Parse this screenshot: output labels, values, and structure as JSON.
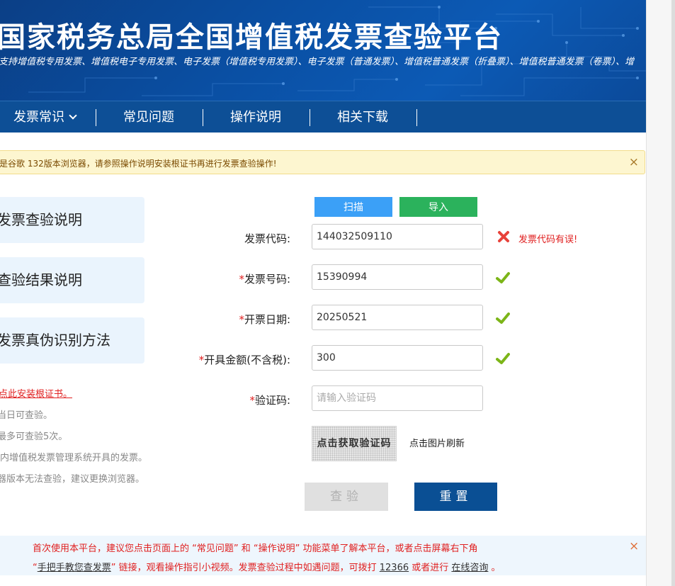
{
  "header": {
    "title": "国家税务总局全国增值税发票查验平台",
    "subtitle": "支持增值税专用发票、增值税电子专用发票、电子发票（增值税专用发票）、电子发票（普通发票）、增值税普通发票（折叠票）、增值税普通发票（卷票）、增"
  },
  "nav": {
    "items": [
      {
        "label": "发票常识"
      },
      {
        "label": "常见问题"
      },
      {
        "label": "操作说明"
      },
      {
        "label": "相关下载"
      }
    ]
  },
  "notice": {
    "text": "是谷歌 132版本浏览器，请参照操作说明安装根证书再进行发票查验操作!",
    "close": "×"
  },
  "left_menu": {
    "items": [
      {
        "label": "发票查验说明"
      },
      {
        "label": "查验结果说明"
      },
      {
        "label": "发票真伪识别方法"
      }
    ],
    "tips": [
      "点此安装根证书。",
      "当日可查验。",
      "最多可查验5次。",
      "内增值税发票管理系统开具的发票。",
      "器版本无法查验，建议更换浏览器。"
    ]
  },
  "form": {
    "scan_label": "扫描",
    "import_label": "导入",
    "invoice_code": {
      "label": "发票代码:",
      "value": "144032509110",
      "error": "发票代码有误!"
    },
    "invoice_number": {
      "required": "*",
      "label": "发票号码:",
      "value": "15390994"
    },
    "issue_date": {
      "required": "*",
      "label": "开票日期:",
      "value": "20250521"
    },
    "amount": {
      "required": "*",
      "label": "开具金额(不含税):",
      "value": "300"
    },
    "captcha": {
      "required": "*",
      "label": "验证码:",
      "value": "",
      "placeholder": "请输入验证码"
    },
    "captcha_image_text": "点击获取验证码",
    "captcha_hint": "点击图片刷新",
    "check_label": "查验",
    "reset_label": "重置"
  },
  "bottom": {
    "line1": "首次使用本平台，建议您点击页面上的 “常见问题” 和 “操作说明” 功能菜单了解本平台，或者点击屏幕右下角",
    "line2_prefix": "“",
    "line2_link1": "手把手教您查发票",
    "line2_mid1": "” 链接，观看操作指引小视频。发票查验过程中如遇问题，可拨打 ",
    "line2_phone": "12366",
    "line2_mid2": " 或者进行 ",
    "line2_link2": "在线咨询",
    "line2_suffix": " 。",
    "close": "×"
  },
  "colors": {
    "header_blue": "#0a4fa3",
    "nav_blue": "#0d4f96",
    "scan_blue": "#3ba0f7",
    "import_green": "#2bb25c",
    "error_red": "#e02020",
    "check_green": "#7cb518",
    "reset_blue": "#0a4f94"
  }
}
